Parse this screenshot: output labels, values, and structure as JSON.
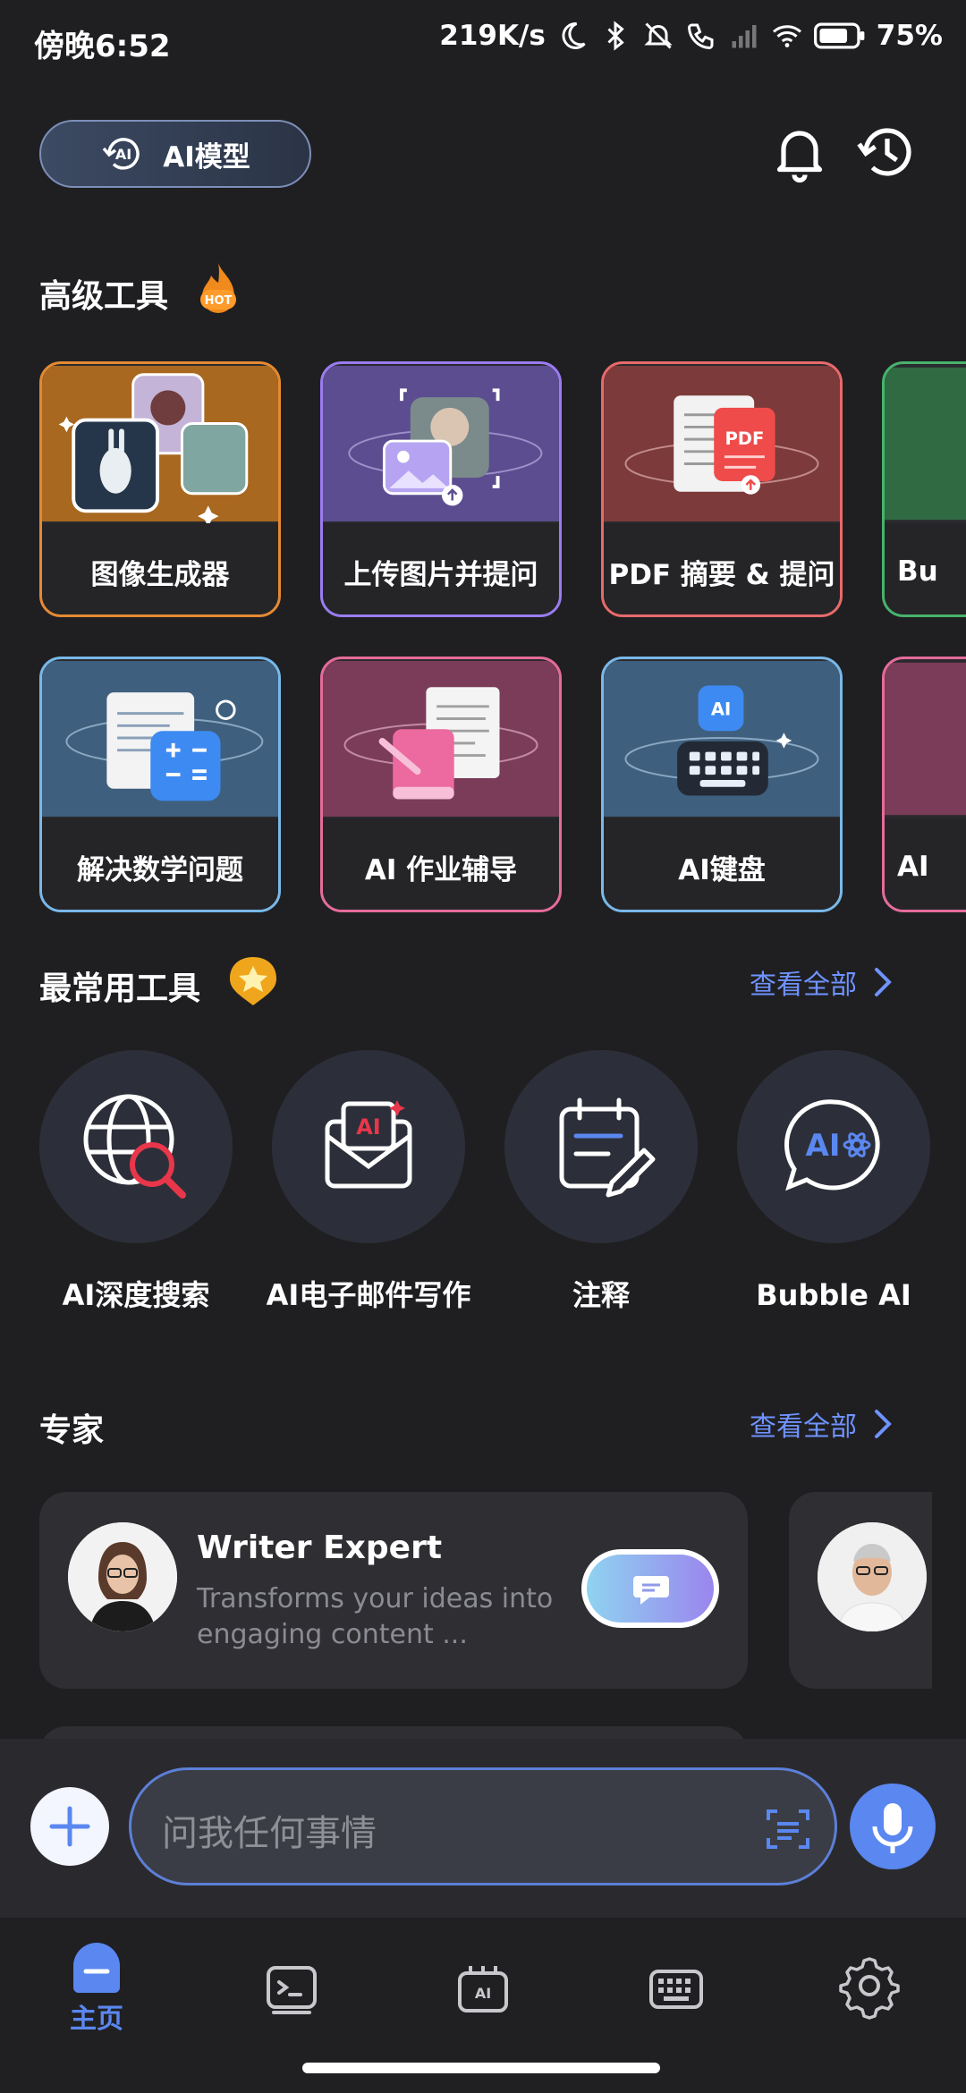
{
  "status_bar": {
    "time": "傍晚6:52",
    "net_speed": "219K/s",
    "battery": "75%"
  },
  "header": {
    "model_button": "AI模型",
    "model_icon_text": "AI"
  },
  "advanced_tools": {
    "title": "高级工具",
    "hot_badge": "HOT",
    "cards": [
      {
        "label": "图像生成器",
        "border": "#e48a33",
        "art_bg": "#a8681f"
      },
      {
        "label": "上传图片并提问",
        "border": "#9a7cf0",
        "art_bg": "#5b4d8f"
      },
      {
        "label": "PDF 摘要 & 提问",
        "border": "#e86a6a",
        "art_bg": "#7c3a3a"
      },
      {
        "label": "Bu",
        "border": "#47b36b",
        "art_bg": "#2f6a43"
      },
      {
        "label": "解决数学问题",
        "border": "#79b8e8",
        "art_bg": "#3f5f7e"
      },
      {
        "label": "AI 作业辅导",
        "border": "#e56c9a",
        "art_bg": "#7a3c58"
      },
      {
        "label": "AI键盘",
        "border": "#79b8e8",
        "art_bg": "#3f5f7e"
      },
      {
        "label": "AI",
        "border": "#e56c9a",
        "art_bg": "#7a3c58"
      }
    ],
    "pdf_badge": "PDF",
    "keyboard_badge": "AI"
  },
  "frequent_tools": {
    "title": "最常用工具",
    "see_all": "查看全部",
    "items": [
      {
        "label": "AI深度搜索"
      },
      {
        "label": "AI电子邮件写作"
      },
      {
        "label": "注释"
      },
      {
        "label": "Bubble AI"
      }
    ],
    "email_icon_text": "AI",
    "bubble_icon_text": "AI"
  },
  "experts": {
    "title": "专家",
    "see_all": "查看全部",
    "cards": [
      {
        "name": "Writer Expert",
        "description": "Transforms your ideas into engaging content ..."
      }
    ]
  },
  "input": {
    "placeholder": "问我任何事情"
  },
  "bottom_nav": {
    "home_label": "主页",
    "active_color": "#5a87f0"
  }
}
